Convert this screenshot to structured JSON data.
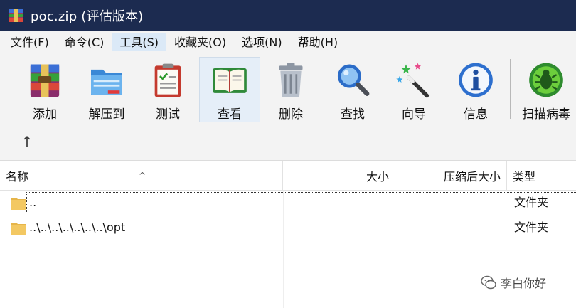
{
  "window": {
    "title": "poc.zip (评估版本)"
  },
  "menu": {
    "items": [
      {
        "label": "文件(F)"
      },
      {
        "label": "命令(C)"
      },
      {
        "label": "工具(S)"
      },
      {
        "label": "收藏夹(O)"
      },
      {
        "label": "选项(N)"
      },
      {
        "label": "帮助(H)"
      }
    ],
    "active_index": 2
  },
  "toolbar": {
    "buttons": [
      {
        "label": "添加",
        "icon": "add-archive-icon"
      },
      {
        "label": "解压到",
        "icon": "extract-folder-icon"
      },
      {
        "label": "测试",
        "icon": "test-clipboard-icon"
      },
      {
        "label": "查看",
        "icon": "view-book-icon"
      },
      {
        "label": "删除",
        "icon": "delete-trash-icon"
      },
      {
        "label": "查找",
        "icon": "find-magnifier-icon"
      },
      {
        "label": "向导",
        "icon": "wizard-wand-icon"
      },
      {
        "label": "信息",
        "icon": "info-icon"
      },
      {
        "label": "扫描病毒",
        "icon": "scan-virus-icon"
      }
    ],
    "active_label": "查看",
    "up_arrow": "↑"
  },
  "filelist": {
    "columns": {
      "name": "名称",
      "size": "大小",
      "packed": "压缩后大小",
      "type": "类型"
    },
    "sort_indicator": "^",
    "rows": [
      {
        "name": "..",
        "type": "文件夹",
        "selected": true
      },
      {
        "name": "..\\..\\..\\..\\..\\..\\..\\opt",
        "type": "文件夹",
        "selected": false
      }
    ]
  },
  "watermark": {
    "text": "李白你好"
  },
  "colors": {
    "titlebar": "#1c2b50",
    "menubar": "#f3f3f3",
    "active_menu": "#dbe9f7",
    "folder": "#f3c862"
  }
}
